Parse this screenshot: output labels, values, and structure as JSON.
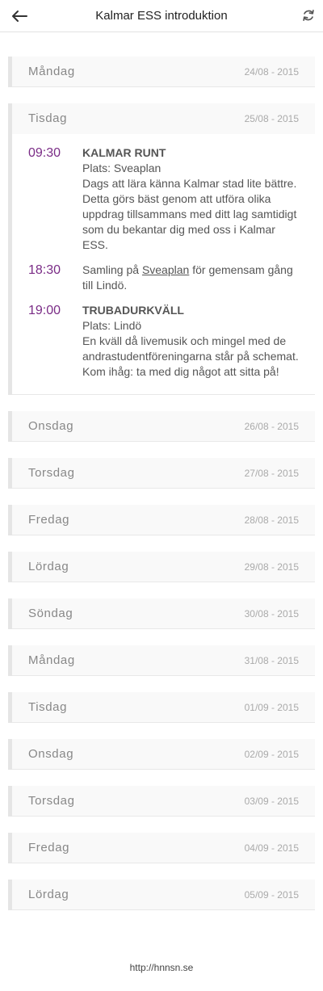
{
  "header": {
    "title": "Kalmar ESS introduktion",
    "back_icon": "arrow-left-icon",
    "refresh_icon": "refresh-icon"
  },
  "days": [
    {
      "name": "Måndag",
      "date": "24/08 - 2015"
    },
    {
      "name": "Tisdag",
      "date": "25/08 - 2015"
    },
    {
      "name": "Onsdag",
      "date": "26/08 - 2015"
    },
    {
      "name": "Torsdag",
      "date": "27/08 - 2015"
    },
    {
      "name": "Fredag",
      "date": "28/08 - 2015"
    },
    {
      "name": "Lördag",
      "date": "29/08 - 2015"
    },
    {
      "name": "Söndag",
      "date": "30/08 - 2015"
    },
    {
      "name": "Måndag",
      "date": "31/08 - 2015"
    },
    {
      "name": "Tisdag",
      "date": "01/09 - 2015"
    },
    {
      "name": "Onsdag",
      "date": "02/09 - 2015"
    },
    {
      "name": "Torsdag",
      "date": "03/09 - 2015"
    },
    {
      "name": "Fredag",
      "date": "04/09 - 2015"
    },
    {
      "name": "Lördag",
      "date": "05/09 - 2015"
    }
  ],
  "events": [
    {
      "time": "09:30",
      "title": "KALMAR RUNT",
      "place": "Plats: Sveaplan",
      "description": "Dags att lära känna Kalmar stad lite bättre. Detta görs bäst genom att utföra olika uppdrag tillsammans med ditt lag samtidigt som du bekantar dig med oss i Kalmar ESS."
    },
    {
      "time": "18:30",
      "pre": "Samling på ",
      "link": "Sveaplan",
      "post": " för gemensam gång till Lindö."
    },
    {
      "time": "19:00",
      "title": "TRUBADURKVÄLL",
      "place": "Plats: Lindö",
      "description": "En kväll då livemusik och mingel med de andrastudentföreningarna står på schemat.",
      "note": "Kom ihåg: ta med dig något att sitta på!"
    }
  ],
  "footer": {
    "url": "http://hnnsn.se"
  },
  "colors": {
    "time": "#7a2c86",
    "border": "#e5e5e5"
  }
}
